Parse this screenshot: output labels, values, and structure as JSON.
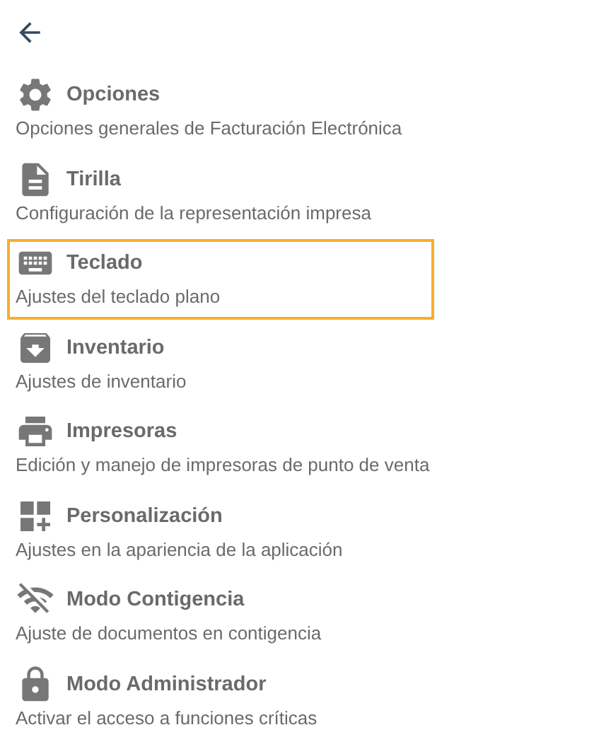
{
  "items": [
    {
      "title": "Opciones",
      "subtitle": "Opciones generales de Facturación Electrónica",
      "selected": false
    },
    {
      "title": "Tirilla",
      "subtitle": "Configuración de la representación impresa",
      "selected": false
    },
    {
      "title": "Teclado",
      "subtitle": "Ajustes del teclado plano",
      "selected": true
    },
    {
      "title": "Inventario",
      "subtitle": "Ajustes de inventario",
      "selected": false
    },
    {
      "title": "Impresoras",
      "subtitle": "Edición y manejo de impresoras de punto de venta",
      "selected": false
    },
    {
      "title": "Personalización",
      "subtitle": "Ajustes en la apariencia de la aplicación",
      "selected": false
    },
    {
      "title": "Modo Contigencia",
      "subtitle": "Ajuste de documentos en contigencia",
      "selected": false
    },
    {
      "title": "Modo Administrador",
      "subtitle": "Activar el acceso a funciones críticas",
      "selected": false
    }
  ]
}
